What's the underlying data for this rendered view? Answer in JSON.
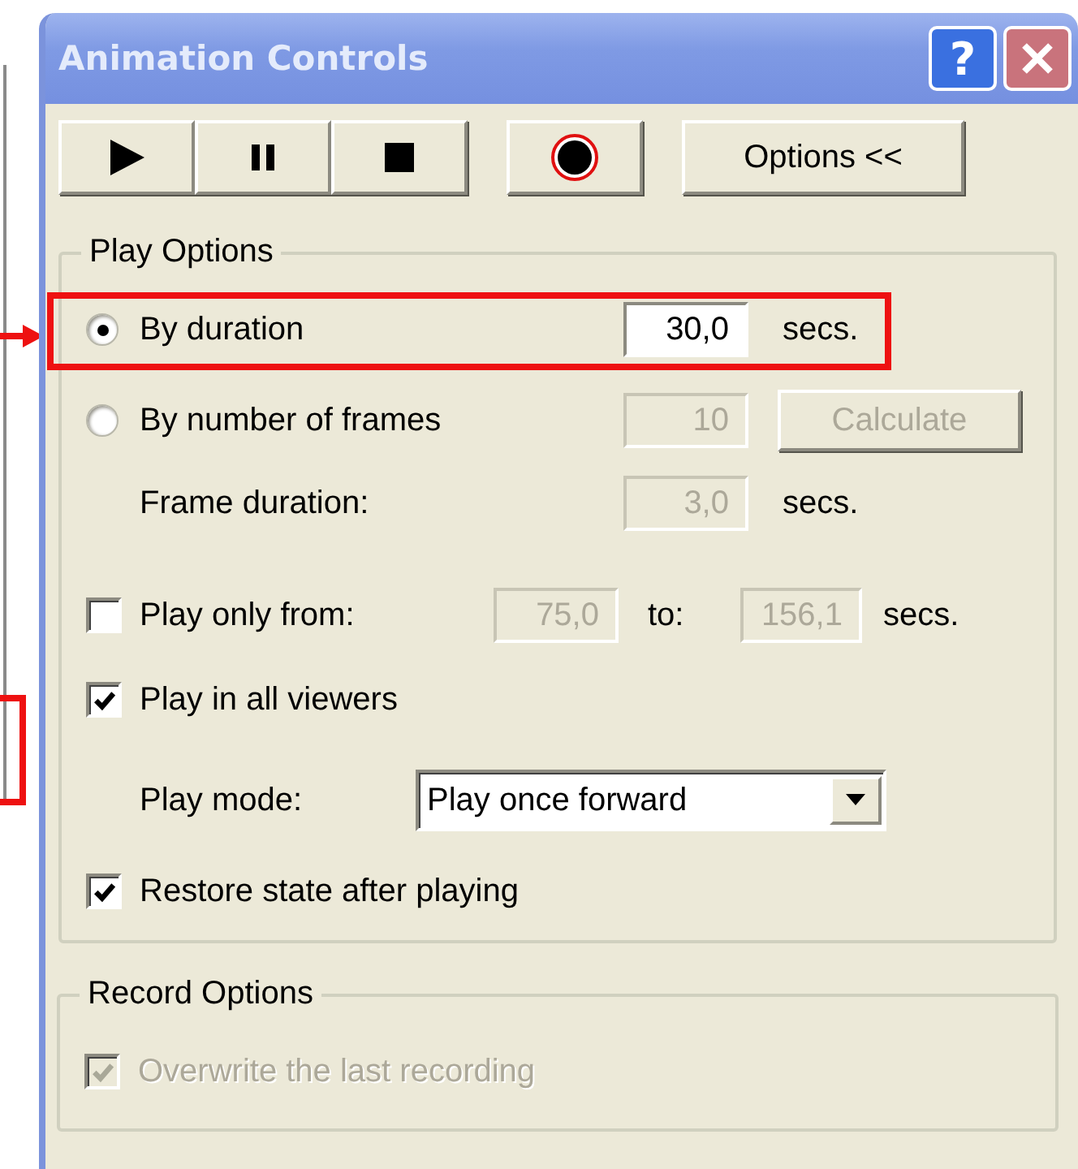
{
  "window": {
    "title": "Animation Controls",
    "help_button": "?"
  },
  "toolbar": [
    {
      "kind": "play"
    },
    {
      "kind": "pause"
    },
    {
      "kind": "stop"
    },
    {
      "kind": "record"
    },
    {
      "kind": "text",
      "label": "Options <<"
    }
  ],
  "play_options": {
    "legend": "Play Options",
    "by_duration": {
      "selected": true,
      "highlighted": true,
      "label": "By duration",
      "value": "30,0",
      "disabled": false,
      "unit": "secs."
    },
    "by_frames": {
      "selected": false,
      "label": "By number of frames",
      "value": "10",
      "disabled": true,
      "button": "Calculate",
      "button_disabled": true
    },
    "frame_duration": {
      "label": "Frame duration:",
      "value": "3,0",
      "disabled": true,
      "unit": "secs."
    },
    "play_only_from": {
      "checked": false,
      "label": "Play only from:",
      "from": "75,0",
      "disabled": true,
      "to_label": "to:",
      "to": "156,1",
      "unit": "secs."
    },
    "play_in_all_viewers": {
      "checked": true,
      "label": "Play in all viewers"
    },
    "play_mode": {
      "label": "Play mode:",
      "value": "Play once forward"
    },
    "restore_state": {
      "checked": true,
      "label": "Restore state after playing"
    }
  },
  "record_options": {
    "legend": "Record Options",
    "overwrite": {
      "checked": true,
      "disabled": true,
      "label": "Overwrite the last recording"
    }
  }
}
